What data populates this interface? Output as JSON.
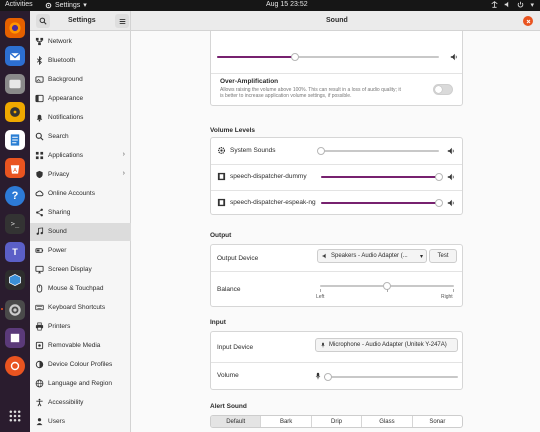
{
  "topbar": {
    "activities": "Activities",
    "app_name": "Settings",
    "clock": "Aug 15  23:52"
  },
  "window": {
    "sidebar_title": "Settings",
    "content_title": "Sound"
  },
  "sidebar": {
    "items": [
      {
        "label": "Network",
        "icon": "network-icon"
      },
      {
        "label": "Bluetooth",
        "icon": "bluetooth-icon"
      },
      {
        "label": "Background",
        "icon": "background-icon"
      },
      {
        "label": "Appearance",
        "icon": "appearance-icon"
      },
      {
        "label": "Notifications",
        "icon": "bell-icon"
      },
      {
        "label": "Search",
        "icon": "search-icon"
      },
      {
        "label": "Applications",
        "icon": "applications-icon",
        "chevron": "›"
      },
      {
        "label": "Privacy",
        "icon": "privacy-icon",
        "chevron": "›"
      },
      {
        "label": "Online Accounts",
        "icon": "cloud-icon"
      },
      {
        "label": "Sharing",
        "icon": "sharing-icon"
      },
      {
        "label": "Sound",
        "icon": "music-note-icon",
        "active": true
      },
      {
        "label": "Power",
        "icon": "power-icon"
      },
      {
        "label": "Screen Display",
        "icon": "display-icon"
      },
      {
        "label": "Mouse & Touchpad",
        "icon": "mouse-icon"
      },
      {
        "label": "Keyboard Shortcuts",
        "icon": "keyboard-icon"
      },
      {
        "label": "Printers",
        "icon": "printer-icon"
      },
      {
        "label": "Removable Media",
        "icon": "media-icon"
      },
      {
        "label": "Device Colour Profiles",
        "icon": "color-profile-icon"
      },
      {
        "label": "Language and Region",
        "icon": "globe-icon"
      },
      {
        "label": "Accessibility",
        "icon": "accessibility-icon"
      },
      {
        "label": "Users",
        "icon": "users-icon"
      }
    ]
  },
  "sound": {
    "master_volume_level": 0.35,
    "over_amplification": {
      "title": "Over-Amplification",
      "description_line1": "Allows raising the volume above 100%. This can result in a loss of audio quality; it",
      "description_line2": "is better to increase application volume settings, if possible.",
      "enabled": false
    },
    "volume_levels": {
      "title": "Volume Levels",
      "items": [
        {
          "label": "System Sounds",
          "level": 0.0
        },
        {
          "label": "speech-dispatcher-dummy",
          "level": 1.0
        },
        {
          "label": "speech-dispatcher-espeak-ng",
          "level": 1.0
        }
      ]
    },
    "output": {
      "title": "Output",
      "device_label": "Output Device",
      "device_value": "Speakers - Audio Adapter (...",
      "test_label": "Test",
      "balance_label": "Balance",
      "balance_left": "Left",
      "balance_right": "Right",
      "balance_level": 0.5
    },
    "input": {
      "title": "Input",
      "device_label": "Input Device",
      "device_value": "Microphone - Audio Adapter (Unitek Y-247A)",
      "volume_label": "Volume",
      "volume_level": 0.03
    },
    "alert_sound": {
      "title": "Alert Sound",
      "options": [
        "Default",
        "Bark",
        "Drip",
        "Glass",
        "Sonar"
      ],
      "selected": "Default"
    }
  },
  "colors": {
    "accent": "#77216f",
    "ubuntu_orange": "#e95420"
  }
}
